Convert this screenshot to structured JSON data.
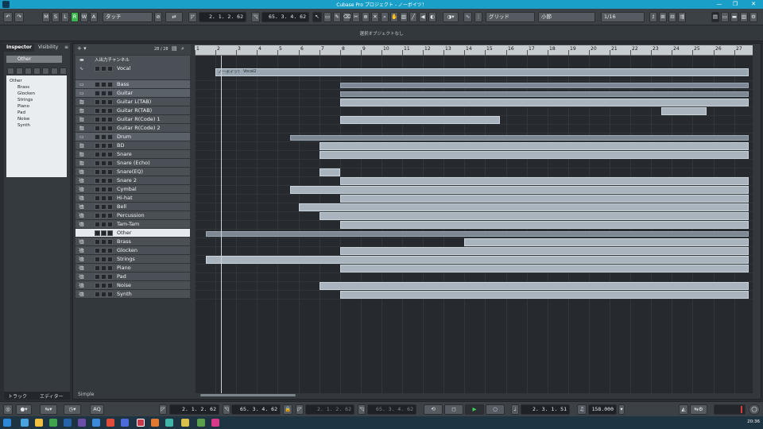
{
  "window": {
    "title": "Cubase Pro プロジェクト - ノーボイツ！",
    "minimize": "—",
    "maximize": "❐",
    "close": "✕"
  },
  "toolbar": {
    "undo": "↶",
    "redo": "↷",
    "m": "M",
    "s": "S",
    "l": "L",
    "r": "R",
    "w": "W",
    "a": "A",
    "automation_mode": "タッチ",
    "left_locator": "2. 1. 2. 62",
    "right_locator": "65. 3. 4. 62",
    "snap_type": "グリッド",
    "grid_type": "小節",
    "quantize": "1/16"
  },
  "info_line": "選択オブジェクトなし",
  "inspector": {
    "tabs": [
      "Inspector",
      "Visibility"
    ],
    "track_name": "Other",
    "tree": [
      "Other",
      "Brass",
      "Glocken",
      "Strings",
      "Piano",
      "Pad",
      "Noise",
      "Synth"
    ],
    "bottom_tabs": [
      "トラック",
      "エディター"
    ]
  },
  "project": {
    "track_count": "28 / 28",
    "io_channel_label": "入出力チャンネル",
    "visibility_label": "Simple",
    "tracks": [
      {
        "num": "",
        "name": "Vocal",
        "type": "audio"
      },
      {
        "num": "",
        "name": "Bass",
        "type": "folder"
      },
      {
        "num": "",
        "name": "Guitar",
        "type": "folder"
      },
      {
        "num": "3",
        "name": "Guitar L(TAB)",
        "type": "midi"
      },
      {
        "num": "4",
        "name": "Guitar R(TAB)",
        "type": "midi"
      },
      {
        "num": "5",
        "name": "Guitar R(Code) 1",
        "type": "midi"
      },
      {
        "num": "6",
        "name": "Guitar R(Code) 2",
        "type": "midi"
      },
      {
        "num": "",
        "name": "Drum",
        "type": "folder"
      },
      {
        "num": "7",
        "name": "BD",
        "type": "midi"
      },
      {
        "num": "8",
        "name": "Snare",
        "type": "midi"
      },
      {
        "num": "9",
        "name": "Snare (Echo)",
        "type": "midi"
      },
      {
        "num": "10",
        "name": "Snare(EQ)",
        "type": "midi"
      },
      {
        "num": "11",
        "name": "Snare 2",
        "type": "midi"
      },
      {
        "num": "12",
        "name": "Cymbal",
        "type": "midi"
      },
      {
        "num": "13",
        "name": "Hi-hat",
        "type": "midi"
      },
      {
        "num": "14",
        "name": "Bell",
        "type": "midi"
      },
      {
        "num": "15",
        "name": "Percussion",
        "type": "midi"
      },
      {
        "num": "16",
        "name": "Tam-Tam",
        "type": "midi"
      },
      {
        "num": "",
        "name": "Other",
        "type": "folder"
      },
      {
        "num": "17",
        "name": "Brass",
        "type": "midi"
      },
      {
        "num": "18",
        "name": "Glocken",
        "type": "midi"
      },
      {
        "num": "19",
        "name": "Strings",
        "type": "midi"
      },
      {
        "num": "20",
        "name": "Piano",
        "type": "midi"
      },
      {
        "num": "21",
        "name": "Pad",
        "type": "midi"
      },
      {
        "num": "22",
        "name": "Noise",
        "type": "midi"
      },
      {
        "num": "23",
        "name": "Synth",
        "type": "midi"
      }
    ],
    "ruler_bars": [
      "1",
      "2",
      "3",
      "4",
      "5",
      "6",
      "7",
      "8",
      "9",
      "10",
      "11",
      "12",
      "13",
      "14",
      "15",
      "16",
      "17",
      "18",
      "19",
      "20",
      "21",
      "22",
      "23",
      "24",
      "25",
      "26",
      "27"
    ],
    "vocal_event_labels": [
      "ノーボイツ！",
      "Vocal2"
    ]
  },
  "transport": {
    "left_locator": "2. 1. 2. 62",
    "right_locator": "65. 3. 4. 62",
    "punch_in": "2. 1. 2. 62",
    "punch_out": "65. 3. 4. 62",
    "position": "2. 3. 1. 51",
    "tempo": "158.000",
    "aq": "AQ"
  },
  "taskbar": {
    "time": "20:36"
  }
}
